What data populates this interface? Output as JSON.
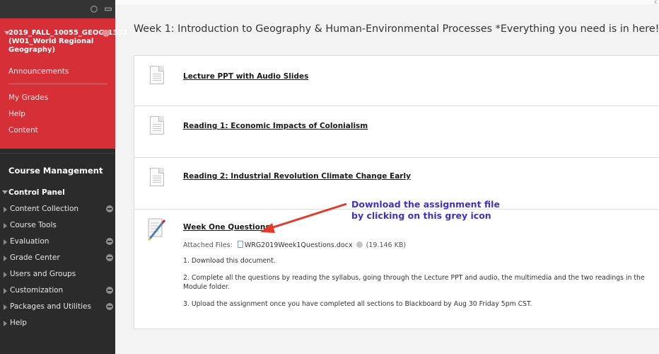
{
  "sidebar": {
    "course_title": "2019_FALL_10055_GEOG_1302 (W01_World Regional Geography)",
    "links": [
      "Announcements",
      "My Grades",
      "Help",
      "Content"
    ],
    "course_management": "Course Management",
    "control_panel": "Control Panel",
    "control_items": [
      {
        "label": "Content Collection",
        "has_menu": true
      },
      {
        "label": "Course Tools",
        "has_menu": false
      },
      {
        "label": "Evaluation",
        "has_menu": true
      },
      {
        "label": "Grade Center",
        "has_menu": true
      },
      {
        "label": "Users and Groups",
        "has_menu": false
      },
      {
        "label": "Customization",
        "has_menu": true
      },
      {
        "label": "Packages and Utilities",
        "has_menu": true
      },
      {
        "label": "Help",
        "has_menu": false
      }
    ],
    "tool_icons": [
      "refresh-icon",
      "folder-icon"
    ]
  },
  "main": {
    "title": "Week 1: Introduction to Geography & Human-Environmental Processes *Everything you need is in here!",
    "items": [
      {
        "link": "Lecture PPT with Audio Slides",
        "icon": "document-icon"
      },
      {
        "link": "Reading 1: Economic Impacts of Colonialism",
        "icon": "document-icon"
      },
      {
        "link": "Reading 2: Industrial Revolution Climate Change Early",
        "icon": "document-icon"
      }
    ],
    "assignment": {
      "link": "Week One Questions",
      "icon": "assignment-icon",
      "attached_label": "Attached Files:",
      "file_name": "WRG2019Week1Questions.docx",
      "file_size": "(19.146 KB)",
      "steps": [
        "1. Download this document.",
        "2. Complete all the questions by reading the syllabus, going through the Lecture PPT and audio, the multimedia and the two readings in the Module folder.",
        "3. Upload the assignment once you have completed all sections to Blackboard by Aug 30 Friday 5pm CST."
      ]
    },
    "callout": {
      "line1": "Download the assignment file",
      "line2": "by clicking on this grey icon"
    }
  },
  "colors": {
    "accent": "#d62f37",
    "callout": "#3b33c9",
    "arrow": "#e53a2a"
  }
}
